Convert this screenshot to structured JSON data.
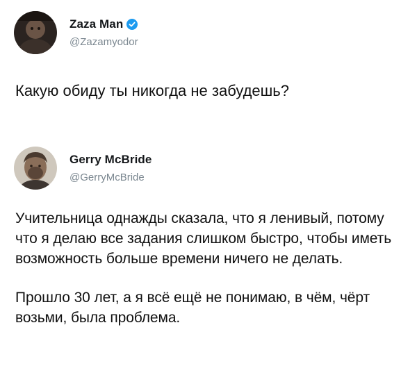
{
  "tweet1": {
    "display_name": "Zaza Man",
    "handle": "@Zazamyodor",
    "verified": true,
    "text": "Какую обиду ты никогда не забудешь?"
  },
  "tweet2": {
    "display_name": "Gerry McBride",
    "handle": "@GerryMcBride",
    "paragraphs": [
      "Учительница  однажды сказала, что я ленивый, потому что я делаю все задания слишком быстро, чтобы иметь возможность больше времени ничего не делать.",
      "Прошло 30 лет, а я всё ещё не понимаю, в чём, чёрт возьми, была проблема."
    ]
  },
  "colors": {
    "verified_badge": "#1d9bf0",
    "handle_text": "#7b8790",
    "body_text": "#111111"
  },
  "icons": {
    "verified": "verified-badge-icon"
  }
}
